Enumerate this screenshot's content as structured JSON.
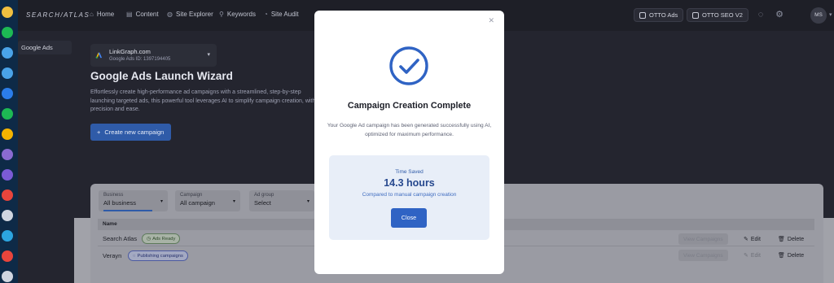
{
  "dock": {
    "icons": [
      {
        "name": "app-icon-1",
        "color": "#f0c040"
      },
      {
        "name": "spotify-icon",
        "color": "#1db954"
      },
      {
        "name": "app-icon-3",
        "color": "#4aa3e8"
      },
      {
        "name": "app-icon-4",
        "color": "#4aa3e8"
      },
      {
        "name": "app-icon-5",
        "color": "#2b7de9"
      },
      {
        "name": "spotify-icon-2",
        "color": "#1db954"
      },
      {
        "name": "chrome-icon",
        "color": "#f4b400"
      },
      {
        "name": "app-icon-8",
        "color": "#8a6bd1"
      },
      {
        "name": "app-icon-9",
        "color": "#7b5bd6"
      },
      {
        "name": "chrome-icon-2",
        "color": "#e8453c"
      },
      {
        "name": "app-icon-11",
        "color": "#d0d6e0"
      },
      {
        "name": "app-icon-12",
        "color": "#2ca5e0"
      },
      {
        "name": "app-icon-13",
        "color": "#e8453c"
      },
      {
        "name": "app-icon-14",
        "color": "#d0d6e0"
      }
    ]
  },
  "topbar": {
    "logo": "SEARCH/ATLAS",
    "nav": [
      {
        "label": "Home",
        "icon": "home-icon"
      },
      {
        "label": "Content",
        "icon": "content-icon"
      },
      {
        "label": "Site Explorer",
        "icon": "globe-icon"
      },
      {
        "label": "Keywords",
        "icon": "key-icon"
      },
      {
        "label": "Site Audit",
        "icon": "audit-icon"
      }
    ],
    "otto_ads": "OTTO Ads",
    "otto_seo": "OTTO SEO V2",
    "avatar_initials": "MS"
  },
  "sidebar": {
    "active_item": "Google Ads"
  },
  "main": {
    "account_name": "LinkGraph.com",
    "account_id": "Google Ads ID: 1397194405",
    "title": "Google Ads Launch Wizard",
    "description": "Effortlessly create high-performance ad campaigns with a streamlined, step-by-step launching targeted ads, this powerful tool leverages AI to simplify campaign creation, with precision and ease.",
    "create_button": "Create new campaign"
  },
  "filters": [
    {
      "label": "Business",
      "value": "All business"
    },
    {
      "label": "Campaign",
      "value": "All campaign"
    },
    {
      "label": "Ad group",
      "value": "Select"
    }
  ],
  "table": {
    "header_name": "Name",
    "rows": [
      {
        "name": "Search Atlas",
        "status": "Ads Ready",
        "view_label": "View Campaigns",
        "edit_label": "Edit",
        "delete_label": "Delete"
      },
      {
        "name": "Verayn",
        "status": "Publishing campaigns",
        "view_label": "View Campaigns",
        "edit_label": "Edit",
        "delete_label": "Delete"
      }
    ]
  },
  "modal": {
    "title": "Campaign Creation Complete",
    "message": "Your Google Ad campaign has been generated successfully using AI, optimized for maximum performance.",
    "stat_label": "Time Saved",
    "stat_value": "14.3 hours",
    "stat_note": "Compared to manual campaign creation",
    "close_button": "Close",
    "accent_color": "#2f63c4"
  }
}
